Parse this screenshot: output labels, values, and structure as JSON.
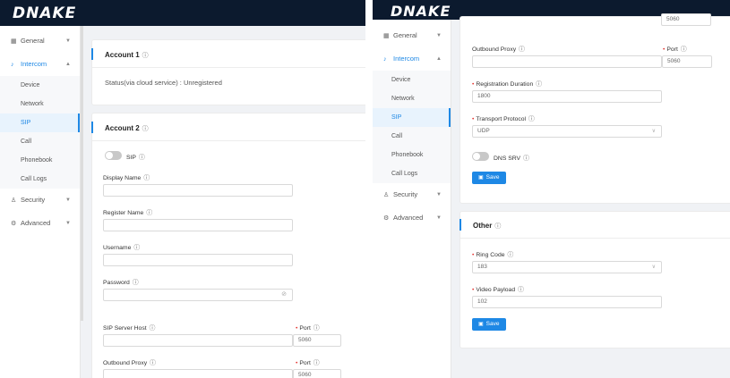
{
  "brand": {
    "logo_text": "DNAKE"
  },
  "sidebar": {
    "general": {
      "label": "General",
      "icon": "grid-icon"
    },
    "intercom": {
      "label": "Intercom",
      "icon": "intercom-icon"
    },
    "sub_items": [
      "Device",
      "Network",
      "SIP",
      "Call",
      "Phonebook",
      "Call Logs"
    ],
    "selected": "SIP",
    "security": {
      "label": "Security",
      "icon": "user-icon"
    },
    "advanced": {
      "label": "Advanced",
      "icon": "gear-icon"
    }
  },
  "left": {
    "account1": {
      "title": "Account 1",
      "status": "Status(via cloud service) : Unregistered"
    },
    "account2": {
      "title": "Account 2",
      "sip_toggle_label": "SIP",
      "display_name_label": "Display Name",
      "register_name_label": "Register Name",
      "username_label": "Username",
      "password_label": "Password",
      "sip_server_host_label": "SIP Server Host",
      "port_label": "Port",
      "port_value": "5060",
      "outbound_proxy_label": "Outbound Proxy",
      "outbound_port_value": "5060"
    }
  },
  "right": {
    "top_port_value": "5060",
    "outbound_proxy_label": "Outbound Proxy",
    "port_label": "Port",
    "outbound_port_value": "5060",
    "registration_duration_label": "Registration Duration",
    "registration_duration_value": "1800",
    "transport_protocol_label": "Transport Protocol",
    "transport_protocol_value": "UDP",
    "dns_srv_label": "DNS SRV",
    "save_label": "Save",
    "other": {
      "title": "Other",
      "ring_code_label": "Ring Code",
      "ring_code_value": "183",
      "video_payload_label": "Video Payload",
      "video_payload_value": "102",
      "save_label": "Save"
    }
  },
  "colors": {
    "accent": "#1e88e5",
    "topbar": "#0c1a2e",
    "required": "#e53935"
  }
}
